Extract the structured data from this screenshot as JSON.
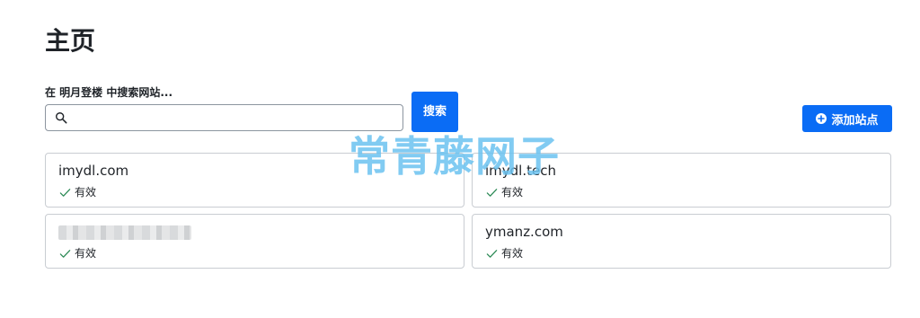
{
  "page": {
    "title": "主页"
  },
  "search": {
    "label": "在 明月登楼 中搜索网站...",
    "value": "",
    "placeholder": "",
    "button_label": "搜索"
  },
  "toolbar": {
    "add_label": "添加站点"
  },
  "sites": [
    {
      "name": "imydl.com",
      "status": "有效",
      "masked": false
    },
    {
      "name": "imydl.tech",
      "status": "有效",
      "masked": false
    },
    {
      "name": "",
      "status": "有效",
      "masked": true
    },
    {
      "name": "ymanz.com",
      "status": "有效",
      "masked": false
    }
  ],
  "watermark": {
    "text": "常青藤网子"
  },
  "colors": {
    "accent": "#0a6cf5",
    "success_check": "#2e8b57",
    "watermark": "#6cc3f0"
  },
  "icons": {
    "search": "search-icon",
    "add": "plus-circle-icon",
    "check": "check-icon"
  }
}
